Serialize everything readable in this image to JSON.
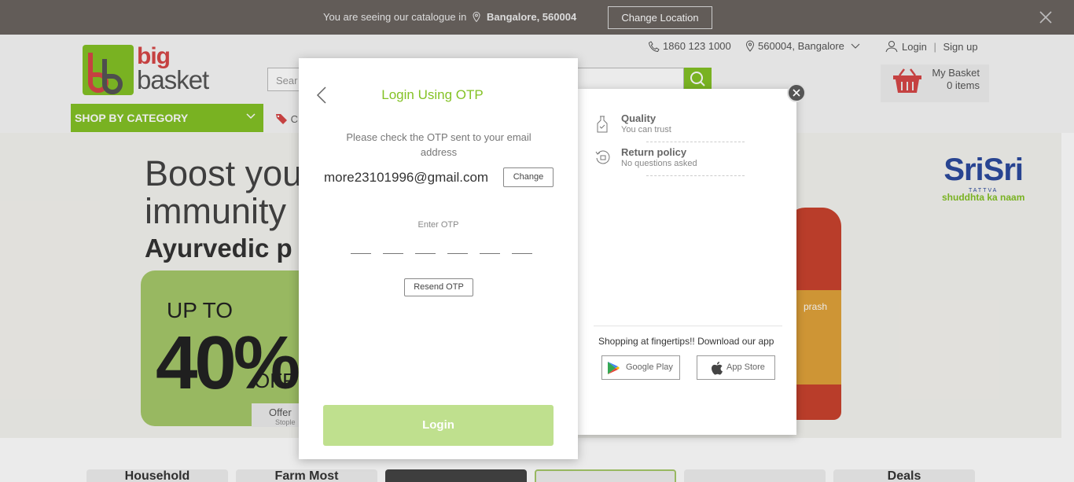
{
  "location_bar": {
    "message": "You are seeing our catalogue in",
    "location": "Bangalore, 560004",
    "change_label": "Change Location"
  },
  "header": {
    "logo_line1": "big",
    "logo_line2": "basket",
    "search_placeholder": "Sear",
    "phone": "1860 123 1000",
    "city": "560004, Bangalore",
    "login": "Login",
    "separator": "|",
    "signup": "Sign up",
    "basket_title": "My Basket",
    "basket_count": "0 items",
    "shop_by_category": "SHOP BY CATEGORY",
    "offers_partial": "C"
  },
  "banner": {
    "line1": "Boost you",
    "line2": "immunity",
    "line3": "Ayurvedic p",
    "upto": "UP TO",
    "percent": "40%",
    "off": "OFF",
    "tag": "Offer",
    "tag_sub": "Stople",
    "brand": "SriSri",
    "brand_sub": "TATTVA",
    "brand_tagline": "shuddhta ka naam",
    "jar_text": "prash"
  },
  "tiles": [
    "Household",
    "Farm Most",
    "",
    "",
    "",
    "Deals"
  ],
  "modal": {
    "title": "Login Using OTP",
    "instruction": "Please check the OTP sent to your email address",
    "email": "more23101996@gmail.com",
    "change_label": "Change",
    "enter_otp_label": "Enter OTP",
    "resend_label": "Resend OTP",
    "login_label": "Login",
    "features": [
      {
        "title": "Quality",
        "desc": "You can trust"
      },
      {
        "title": "Return policy",
        "desc": "No questions asked"
      }
    ],
    "app_title": "Shopping at fingertips!! Download our app",
    "google_play": "Google Play",
    "app_store": "App Store"
  },
  "colors": {
    "brand_green": "#84c225",
    "brand_red": "#d64747",
    "login_button_disabled": "#bfe08e"
  }
}
